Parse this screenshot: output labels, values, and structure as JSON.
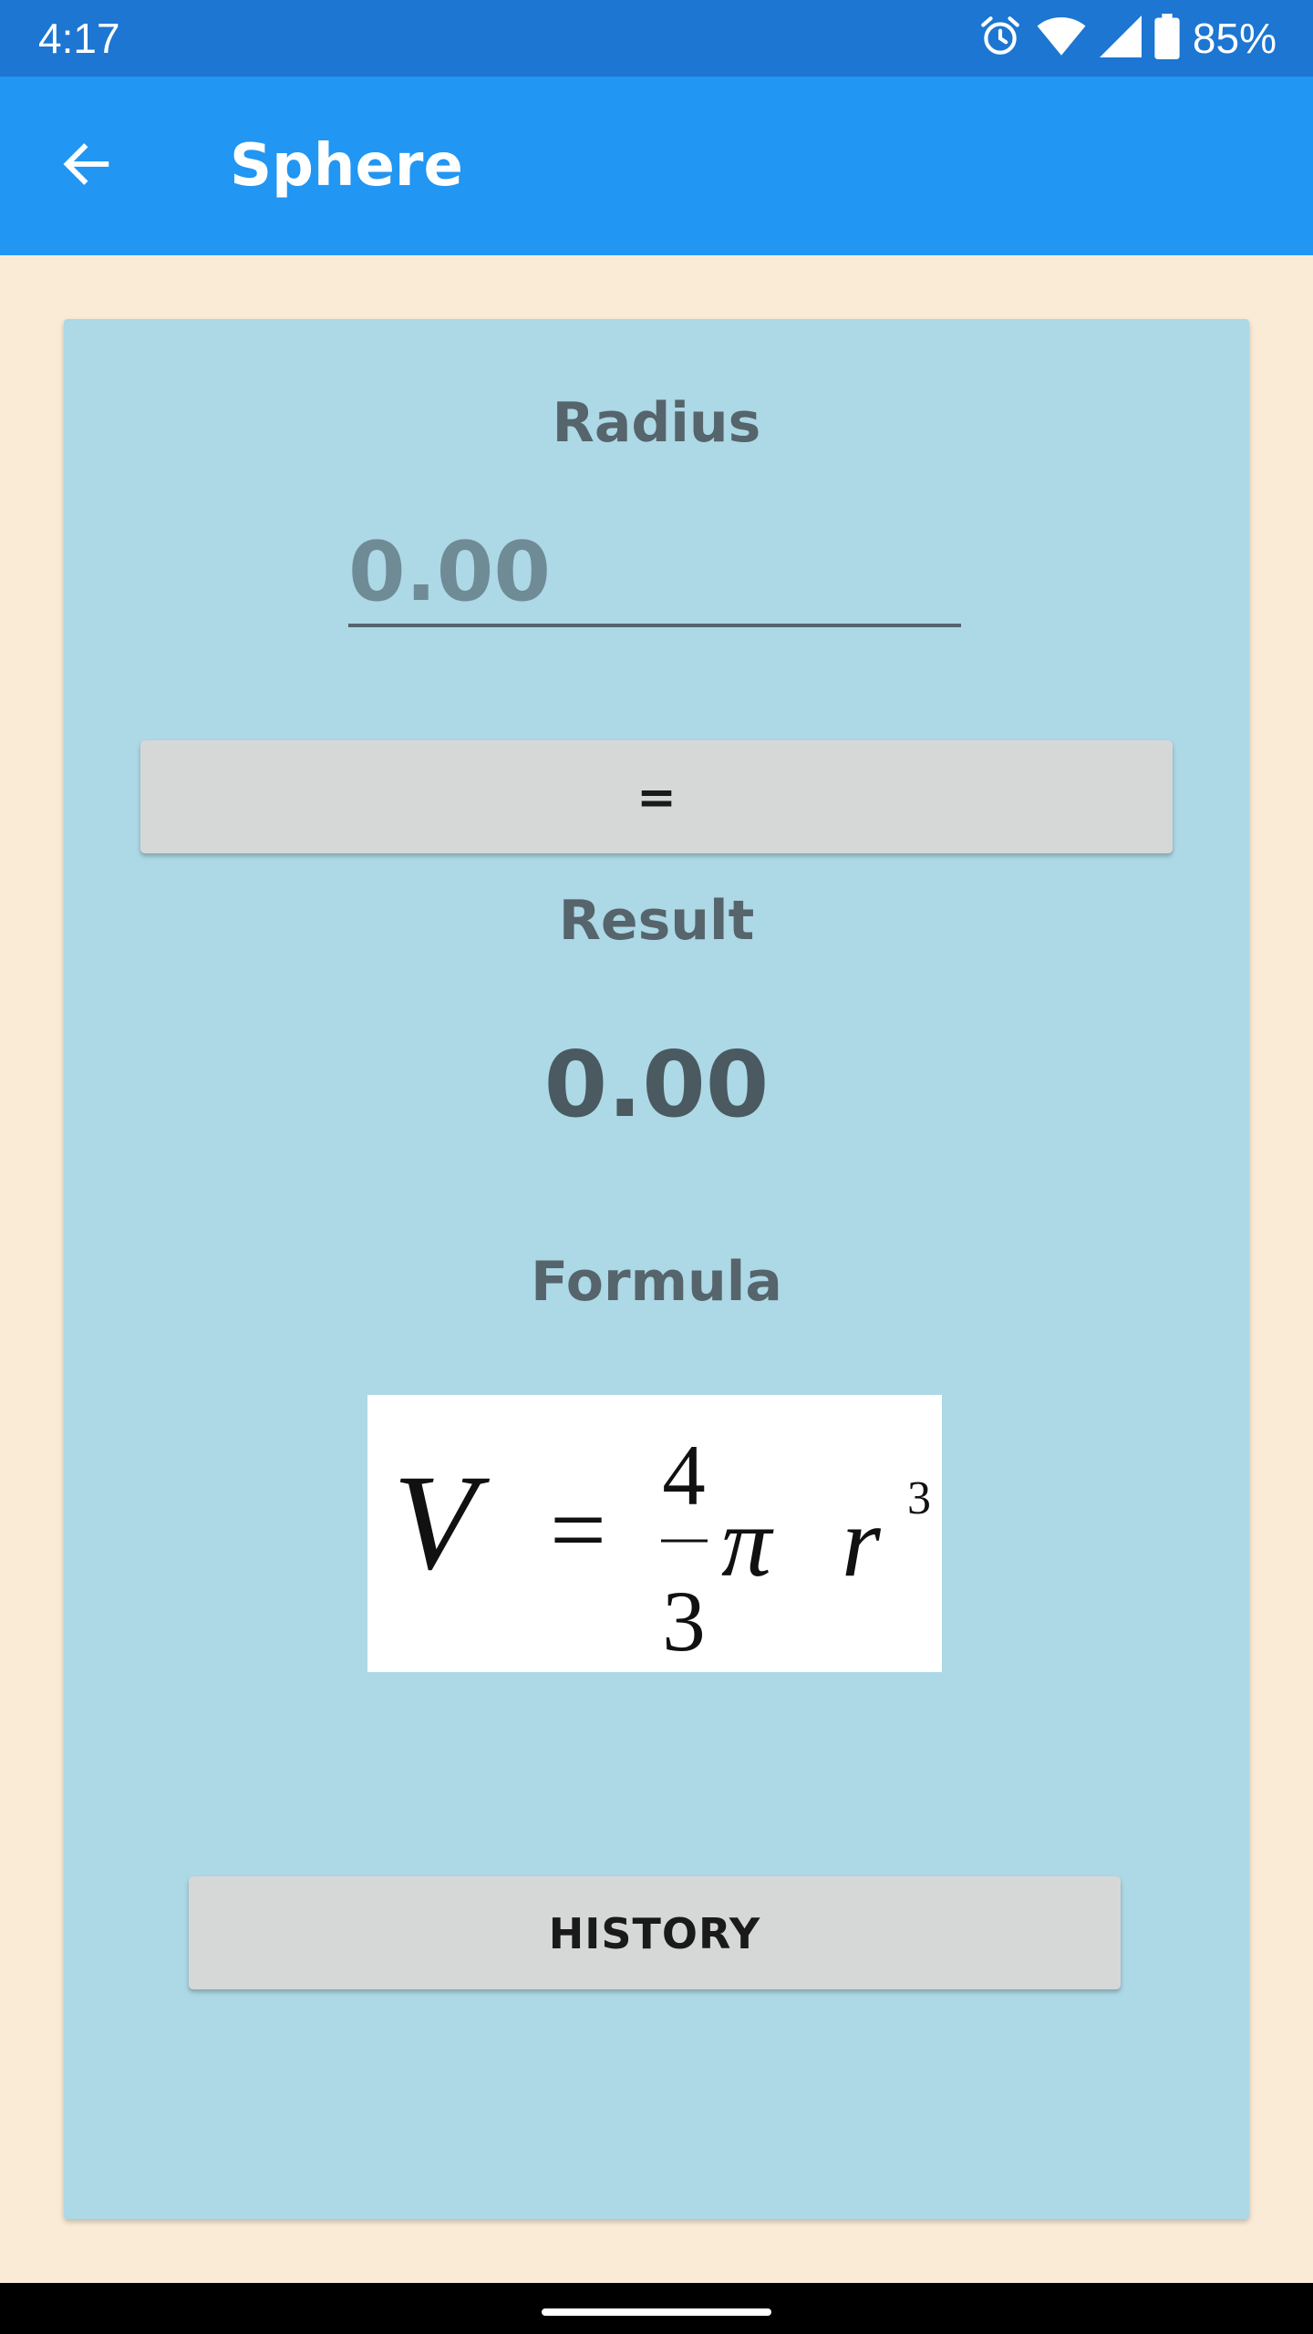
{
  "status_bar": {
    "time": "4:17",
    "battery_percent": "85%",
    "icons": [
      "alarm-icon",
      "wifi-icon",
      "signal-icon",
      "battery-icon"
    ]
  },
  "app_bar": {
    "title": "Sphere",
    "back_icon": "arrow-back-icon"
  },
  "calculator": {
    "radius_label": "Radius",
    "radius_input": {
      "value": "",
      "placeholder": "0.00"
    },
    "equals_label": "=",
    "result_label": "Result",
    "result_value": "0.00",
    "formula_label": "Formula",
    "formula": {
      "lhs": "V",
      "eq": "=",
      "numerator": "4",
      "denominator": "3",
      "pi": "π",
      "var": "r",
      "exponent": "3"
    },
    "history_label": "HISTORY"
  },
  "colors": {
    "status_bar": "#1C76D2",
    "app_bar": "#2196F3",
    "background": "#FAEBD7",
    "card": "#ADD8E6",
    "text": "#56646B",
    "button": "#D6D8D8"
  }
}
